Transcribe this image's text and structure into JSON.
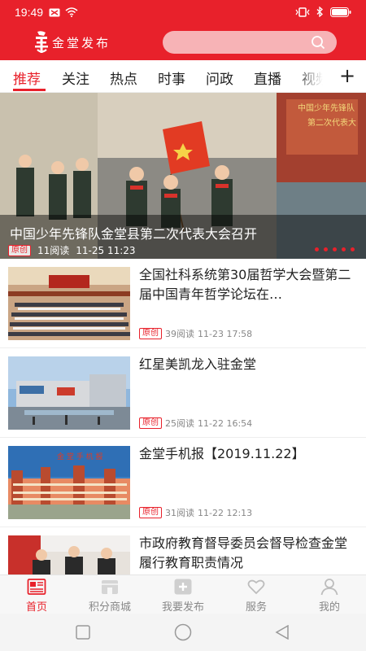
{
  "status_bar": {
    "time": "19:49"
  },
  "header": {
    "app_name": "金堂发布",
    "search": {
      "placeholder": ""
    }
  },
  "tabs": [
    {
      "label": "推荐",
      "active": true
    },
    {
      "label": "关注"
    },
    {
      "label": "热点"
    },
    {
      "label": "时事"
    },
    {
      "label": "问政"
    },
    {
      "label": "直播"
    },
    {
      "label": "视频"
    }
  ],
  "hero": {
    "title": "中国少年先锋队金堂县第二次代表大会召开",
    "badge": "原创",
    "reads": "11阅读",
    "time": "11-25 11:23",
    "banner_text_line1": "中国少年先锋队",
    "banner_text_line2": "第二次代表大",
    "slide_count": 5,
    "active_slide": 1
  },
  "news": [
    {
      "title": "全国社科系统第30届哲学大会暨第二届中国青年哲学论坛在…",
      "badge": "原创",
      "reads": "39阅读",
      "time": "11-23 17:58"
    },
    {
      "title": "红星美凯龙入驻金堂",
      "badge": "原创",
      "reads": "25阅读",
      "time": "11-22 16:54"
    },
    {
      "title": "金堂手机报【2019.11.22】",
      "badge": "原创",
      "reads": "31阅读",
      "time": "11-22 12:13"
    },
    {
      "title": "市政府教育督导委员会督导检查金堂履行教育职责情况",
      "badge": "",
      "reads": "",
      "time": ""
    }
  ],
  "bottom_nav": [
    {
      "label": "首页",
      "icon": "newspaper-icon",
      "active": true
    },
    {
      "label": "积分商城",
      "icon": "shop-icon"
    },
    {
      "label": "我要发布",
      "icon": "add-post-icon"
    },
    {
      "label": "服务",
      "icon": "heart-icon"
    },
    {
      "label": "我的",
      "icon": "user-icon"
    }
  ],
  "colors": {
    "brand_red": "#e8212b",
    "nav_gray": "#888888"
  }
}
